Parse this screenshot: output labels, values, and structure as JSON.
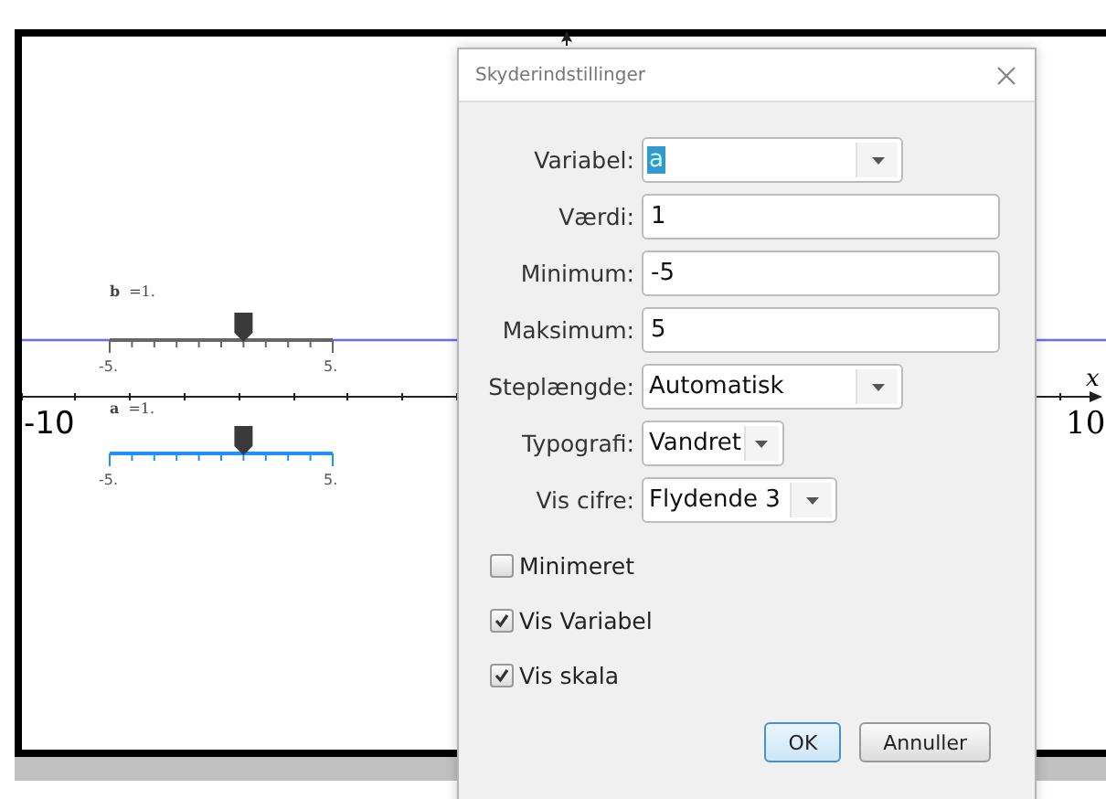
{
  "graph": {
    "x_min_label": "-10",
    "x_max_label": "10",
    "x_axis_label": "x"
  },
  "sliders": [
    {
      "name": "b",
      "value": "=1.",
      "min_label": "-5.",
      "max_label": "5.",
      "level": 0.6,
      "selected": false
    },
    {
      "name": "a",
      "value": "=1.",
      "min_label": "-5.",
      "max_label": "5.",
      "level": 0.6,
      "selected": true
    }
  ],
  "dialog": {
    "title": "Skyderindstillinger",
    "fields": [
      {
        "kind": "dropdown",
        "label": "Variabel:",
        "value": "a",
        "value_selected": true
      },
      {
        "kind": "text",
        "label": "Værdi:",
        "value": "1"
      },
      {
        "kind": "text",
        "label": "Minimum:",
        "value": "-5"
      },
      {
        "kind": "text",
        "label": "Maksimum:",
        "value": "5"
      },
      {
        "kind": "dropdown",
        "label": "Steplængde:",
        "value": "Automatisk",
        "value_selected": false
      },
      {
        "kind": "dropdown",
        "label": "Typografi:",
        "value": "Vandret",
        "value_selected": false
      },
      {
        "kind": "dropdown",
        "label": "Vis cifre:",
        "value": "Flydende 3",
        "value_selected": false
      }
    ],
    "checkboxes": [
      {
        "label": "Minimeret",
        "checked": false
      },
      {
        "label": "Vis Variabel",
        "checked": true
      },
      {
        "label": "Vis skala",
        "checked": true
      }
    ],
    "buttons": [
      {
        "label": "OK",
        "default": true
      },
      {
        "label": "Annuller",
        "default": false
      }
    ]
  }
}
